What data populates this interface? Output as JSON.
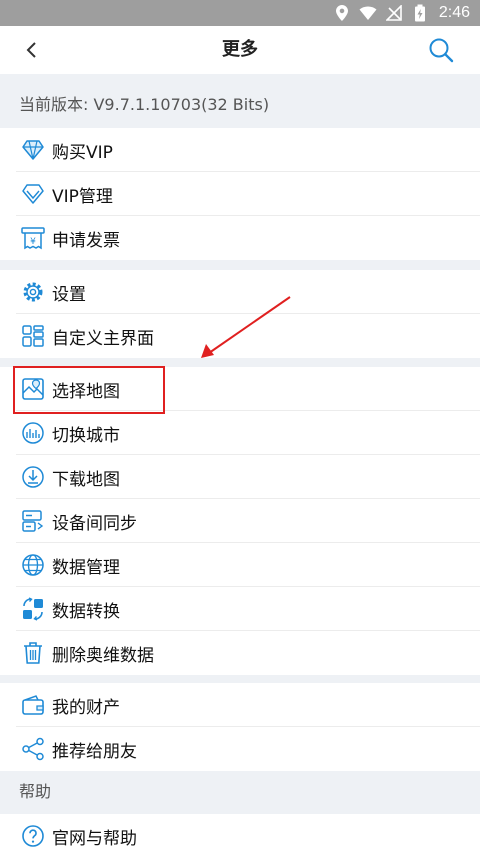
{
  "status_bar": {
    "time": "2:46"
  },
  "header": {
    "title": "更多",
    "back_icon": "chevron-left-icon",
    "search_icon": "search-icon"
  },
  "version_text": "当前版本: V9.7.1.10703(32 Bits)",
  "groups": [
    {
      "items": [
        {
          "label": "购买VIP",
          "icon": "diamond-icon"
        },
        {
          "label": "VIP管理",
          "icon": "vip-diamond-outline-icon"
        },
        {
          "label": "申请发票",
          "icon": "invoice-icon"
        }
      ]
    },
    {
      "items": [
        {
          "label": "设置",
          "icon": "gear-icon"
        },
        {
          "label": "自定义主界面",
          "icon": "grid-layout-icon"
        }
      ]
    },
    {
      "items": [
        {
          "label": "选择地图",
          "icon": "map-icon"
        },
        {
          "label": "切换城市",
          "icon": "city-icon"
        },
        {
          "label": "下载地图",
          "icon": "download-icon"
        },
        {
          "label": "设备间同步",
          "icon": "sync-devices-icon"
        },
        {
          "label": "数据管理",
          "icon": "globe-icon"
        },
        {
          "label": "数据转换",
          "icon": "convert-icon"
        },
        {
          "label": "删除奥维数据",
          "icon": "trash-icon"
        }
      ]
    },
    {
      "items": [
        {
          "label": "我的财产",
          "icon": "wallet-icon"
        },
        {
          "label": "推荐给朋友",
          "icon": "share-icon"
        }
      ]
    }
  ],
  "help_section": {
    "title": "帮助",
    "items": [
      {
        "label": "官网与帮助",
        "icon": "help-circle-icon"
      }
    ]
  },
  "colors": {
    "accent": "#1f8ad6",
    "annotation": "#e02020",
    "background": "#eef1f5"
  }
}
